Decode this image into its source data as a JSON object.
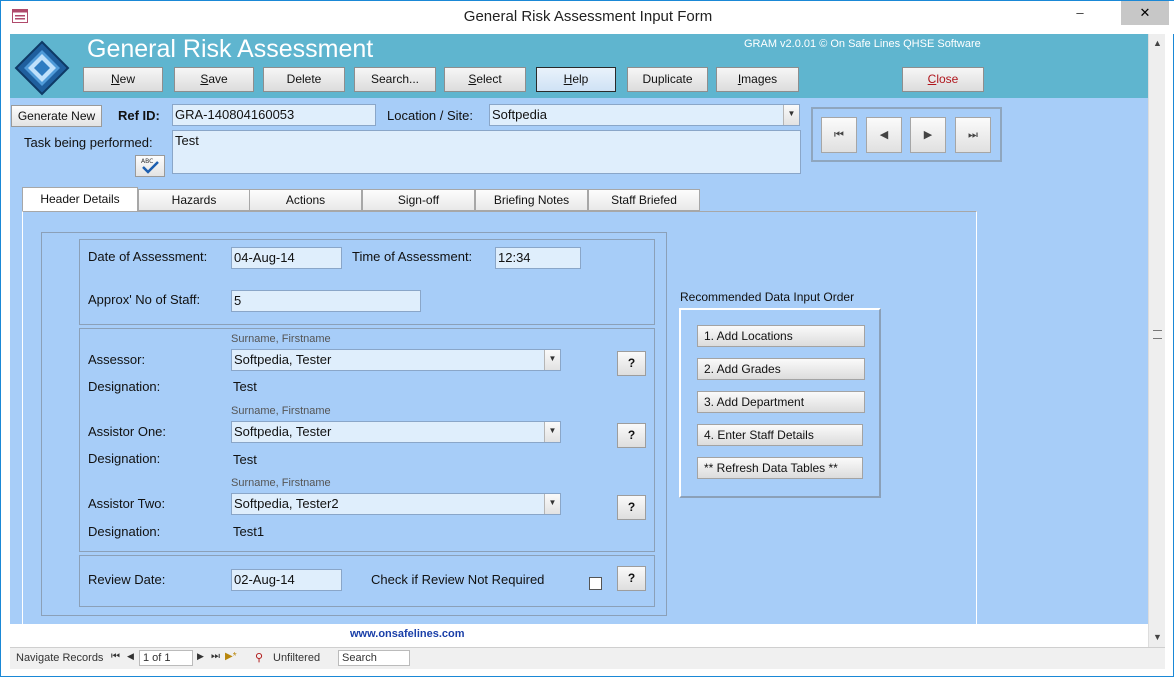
{
  "window": {
    "title": "General Risk Assessment Input Form",
    "minimize_glyph": "–",
    "close_glyph": "✕"
  },
  "header": {
    "app_title": "General Risk Assessment",
    "version": "GRAM v2.0.01 © On Safe Lines QHSE Software",
    "buttons": {
      "new": "New",
      "save": "Save",
      "delete": "Delete",
      "search": "Search...",
      "select": "Select",
      "help": "Help",
      "duplicate": "Duplicate",
      "images": "Images",
      "close": "Close"
    }
  },
  "record": {
    "generate_new": "Generate New",
    "ref_id_label": "Ref ID:",
    "ref_id_value": "GRA-140804160053",
    "location_label": "Location / Site:",
    "location_value": "Softpedia",
    "task_label": "Task being performed:",
    "task_value": "Test"
  },
  "nav_glyphs": {
    "first": "⏮",
    "prev": "◀",
    "next": "▶",
    "last": "⏭"
  },
  "tabs": [
    "Header Details",
    "Hazards",
    "Actions",
    "Sign-off",
    "Briefing Notes",
    "Staff Briefed"
  ],
  "details": {
    "date_label": "Date of Assessment:",
    "date_value": "04-Aug-14",
    "time_label": "Time of Assessment:",
    "time_value": "12:34",
    "staff_label": "Approx' No of Staff:",
    "staff_value": "5",
    "name_hint": "Surname, Firstname",
    "designation_label": "Designation:",
    "q_label": "?",
    "assessor_label": "Assessor:",
    "assessor_value": "Softpedia, Tester",
    "assessor_designation": "Test",
    "assistor_one_label": "Assistor One:",
    "assistor_one_value": "Softpedia, Tester",
    "assistor_one_designation": "Test",
    "assistor_two_label": "Assistor Two:",
    "assistor_two_value": "Softpedia, Tester2",
    "assistor_two_designation": "Test1",
    "review_label": "Review Date:",
    "review_value": "02-Aug-14",
    "review_check_label": "Check if Review Not Required"
  },
  "recommended": {
    "title": "Recommended Data Input Order",
    "items": [
      "1. Add Locations",
      "2. Add Grades",
      "3. Add Department",
      "4. Enter Staff Details",
      "** Refresh Data Tables **"
    ]
  },
  "footer": {
    "website": "www.onsafelines.com"
  },
  "statusbar": {
    "navigate_label": "Navigate Records",
    "record_position": "1 of 1",
    "filter_label": "Unfiltered",
    "search_label": "Search"
  }
}
